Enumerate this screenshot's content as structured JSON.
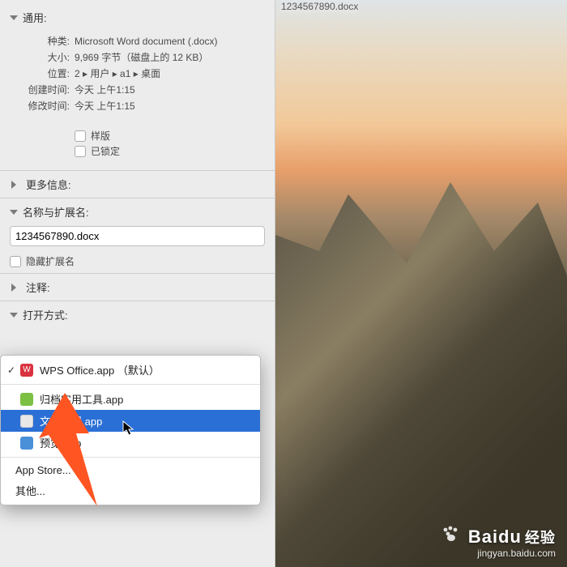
{
  "rightPanel": {
    "fileLabel": "1234567890.docx"
  },
  "general": {
    "title": "通用:",
    "rows": [
      {
        "label": "种类:",
        "value": "Microsoft Word document (.docx)"
      },
      {
        "label": "大小:",
        "value": "9,969 字节（磁盘上的 12 KB）"
      },
      {
        "label": "位置:",
        "value": "2 ▸ 用户 ▸ a1 ▸ 桌面"
      },
      {
        "label": "创建时间:",
        "value": "今天 上午1:15"
      },
      {
        "label": "修改时间:",
        "value": "今天 上午1:15"
      }
    ],
    "checkboxes": {
      "template": "样版",
      "locked": "已锁定"
    }
  },
  "moreInfo": {
    "title": "更多信息:"
  },
  "nameExt": {
    "title": "名称与扩展名:",
    "value": "1234567890.docx",
    "hideExt": "隐藏扩展名"
  },
  "comments": {
    "title": "注释:"
  },
  "openWith": {
    "title": "打开方式:"
  },
  "menu": {
    "wps": "WPS Office.app  （默认）",
    "archive": "归档实用工具.app",
    "textedit": "文本编辑.app",
    "preview": "预览.app",
    "appstore": "App Store...",
    "other": "其他..."
  },
  "watermark": {
    "logo": "Baidu",
    "logoCn": "经验",
    "sub": "jingyan.baidu.com"
  }
}
